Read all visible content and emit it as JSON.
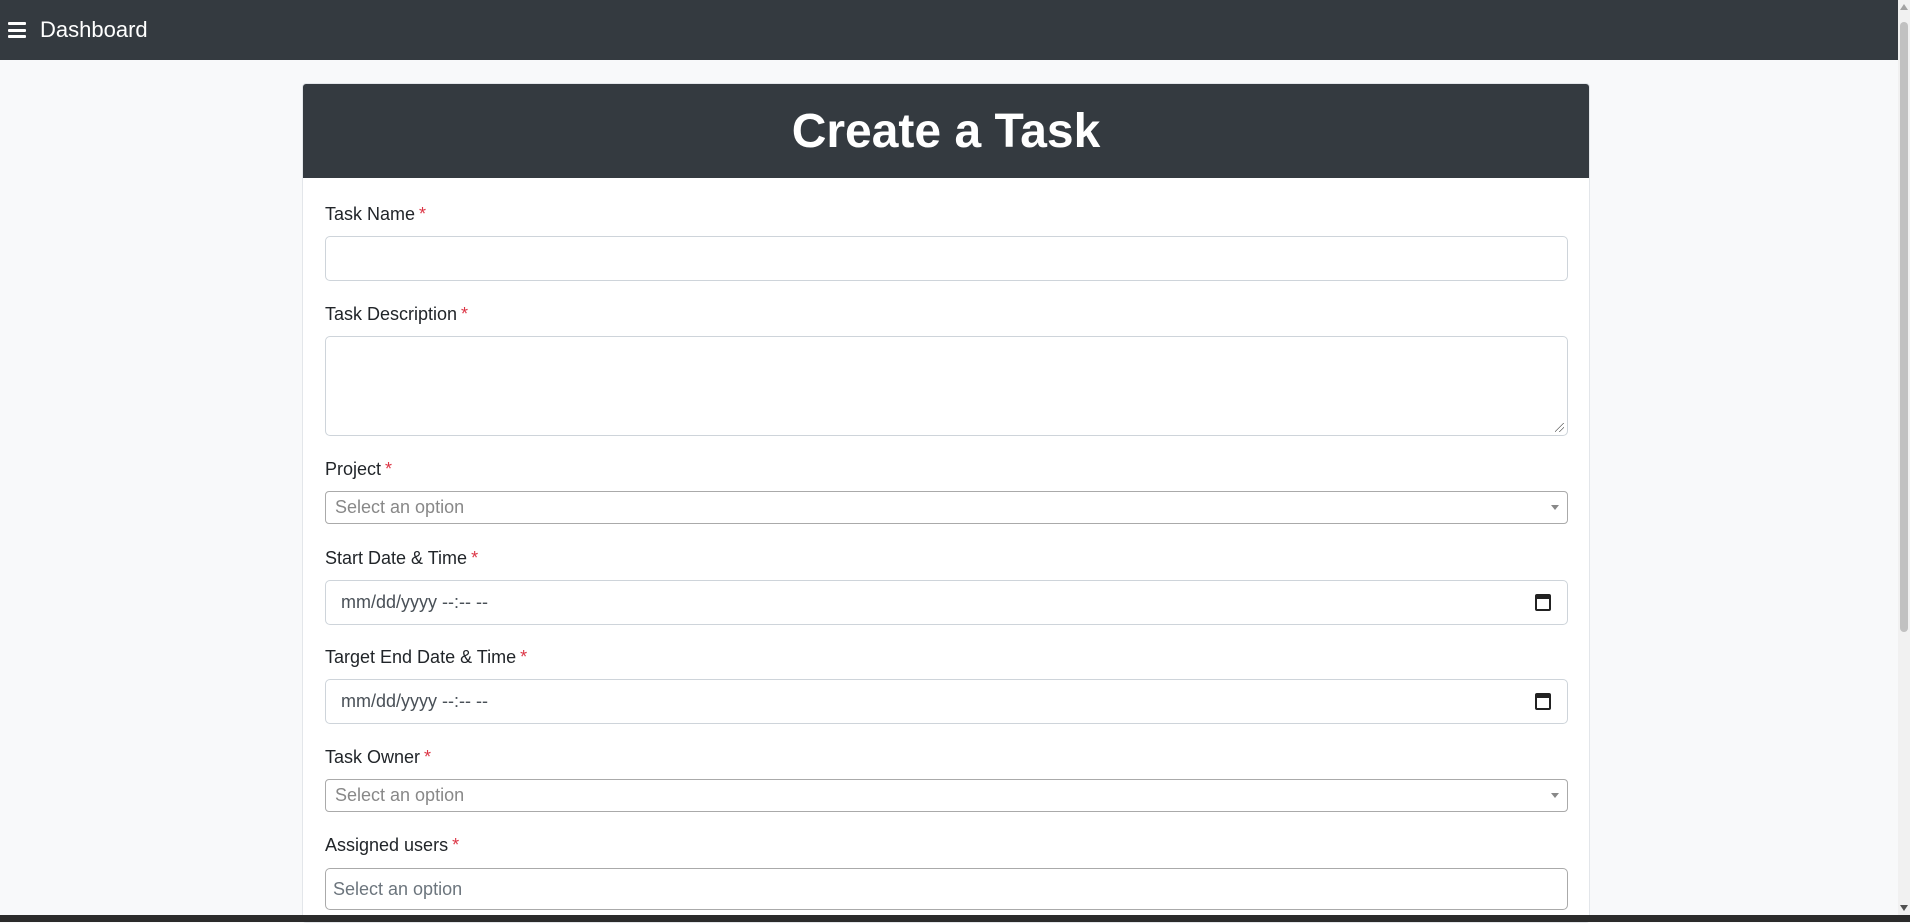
{
  "navbar": {
    "menu_icon": "hamburger-menu-icon",
    "title": "Dashboard"
  },
  "card": {
    "title": "Create a Task"
  },
  "form": {
    "required_marker": "*",
    "task_name": {
      "label": "Task Name",
      "value": ""
    },
    "task_description": {
      "label": "Task Description",
      "value": ""
    },
    "project": {
      "label": "Project",
      "placeholder": "Select an option"
    },
    "start_datetime": {
      "label": "Start Date & Time",
      "placeholder": "mm/dd/yyyy --:-- --"
    },
    "target_end_datetime": {
      "label": "Target End Date & Time",
      "placeholder": "mm/dd/yyyy --:-- --"
    },
    "task_owner": {
      "label": "Task Owner",
      "placeholder": "Select an option"
    },
    "assigned_users": {
      "label": "Assigned users",
      "placeholder": "Select an option"
    }
  },
  "colors": {
    "header_bg": "#343a40",
    "required": "#dc3545",
    "page_bg": "#f8f9fa"
  }
}
